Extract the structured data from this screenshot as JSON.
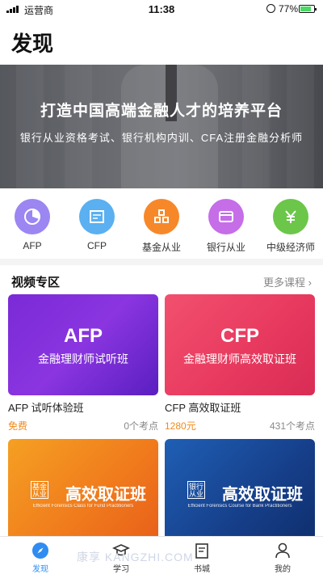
{
  "status_bar": {
    "carrier": "运营商",
    "time": "11:38",
    "battery": "77%",
    "battery_level": 0.77
  },
  "page": {
    "title": "发现"
  },
  "banner": {
    "title": "打造中国高端金融人才的培养平台",
    "subtitle": "银行从业资格考试、银行机构内训、CFA注册金融分析师"
  },
  "categories": [
    {
      "label": "AFP",
      "icon": "pie-chart-icon",
      "color": "#9b86f2"
    },
    {
      "label": "CFP",
      "icon": "certificate-icon",
      "color": "#5ab0f0"
    },
    {
      "label": "基金从业",
      "icon": "fund-icon",
      "color": "#f7882a"
    },
    {
      "label": "银行从业",
      "icon": "card-icon",
      "color": "#c56ee8"
    },
    {
      "label": "中级经济师",
      "icon": "yuan-icon",
      "color": "#6cc64a"
    }
  ],
  "section": {
    "title": "视频专区",
    "more": "更多课程"
  },
  "courses": [
    {
      "thumb_big": "AFP",
      "thumb_small": "金融理财师试听班",
      "name": "AFP 试听体验班",
      "price": "免费",
      "points": "0个考点"
    },
    {
      "thumb_big": "CFP",
      "thumb_small": "金融理财师高效取证班",
      "name": "CFP 高效取证班",
      "price": "1280元",
      "points": "431个考点"
    },
    {
      "thumb_big": "高效取证班",
      "tag": "基金从业",
      "thumb_small": "Efficient Forensics Class for Fund Practitioners"
    },
    {
      "thumb_big": "高效取证班",
      "tag": "银行从业",
      "thumb_small": "Efficient Forensics Course for Bank Practitioners"
    }
  ],
  "tabs": [
    {
      "label": "发现",
      "icon": "compass-icon",
      "active": true
    },
    {
      "label": "学习",
      "icon": "graduation-cap-icon"
    },
    {
      "label": "书城",
      "icon": "book-icon"
    },
    {
      "label": "我的",
      "icon": "user-icon"
    }
  ],
  "watermark": "康享  KANGZHI.COM",
  "colors": {
    "accent": "#2f8cf0",
    "price": "#f08a1a"
  }
}
